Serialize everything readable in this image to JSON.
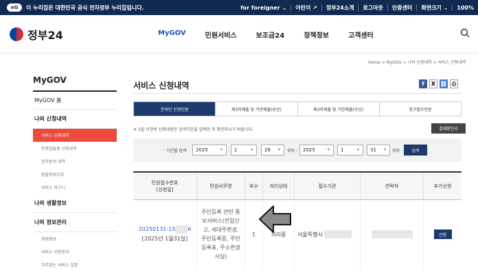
{
  "topbar": {
    "notice": "이 누리집은 대한민국 공식 전자정부 누리집입니다.",
    "links": [
      "for foreigner ⌄",
      "어린이 ↗",
      "정부24소개",
      "로그아웃",
      "인증센터",
      "화면크기 ⌄",
      "100%"
    ]
  },
  "header": {
    "logo_text": "정부24",
    "nav": [
      "MyGOV",
      "민원서비스",
      "보조금24",
      "정책정보",
      "고객센터"
    ]
  },
  "breadcrumb": "Home  >  MyGOV  >  나의 신청내역  >  서비스 신청내역",
  "sidebar": {
    "title": "MyGOV",
    "home": "MyGOV 홈",
    "group1": "나의 신청내역",
    "group1_items": [
      "서비스 신청내역",
      "온종일돌봄 신청내역",
      "전자문서 내역",
      "환불정보조회",
      "서비스 바구니"
    ],
    "group2": "나의 생활정보",
    "group3": "나의 정보관리",
    "group3_items": [
      "회원정보",
      "서비스 이용동의",
      "자주찾는 서비스 설정"
    ]
  },
  "main": {
    "title": "서비스 신청내역",
    "tabs": [
      "온라인 신청민원",
      "제3자제출 및 기관제출(송신)",
      "제3자제출 및 기관제출(수신)",
      "청구접수민원"
    ],
    "note": "※ 3일 이전의 신청내용은 검색기간을 입력한 후 확인하시기 바랍니다.",
    "cert_button": "결제확인서",
    "filter": {
      "label": "· 기간별 검색",
      "from_year": "2025",
      "from_month": "1",
      "from_day": "28",
      "sep": "부터 -",
      "to_year": "2025",
      "to_month": "1",
      "to_day": "31",
      "until": "까지",
      "search": "검색"
    },
    "table": {
      "headers": [
        "민원접수번호\n[신청일]",
        "민원사무명",
        "부수",
        "처리상태",
        "접수기관",
        "연락처",
        "추가신청"
      ],
      "row": {
        "receipt_no": "20250131-15",
        "receipt_no_tail": "6",
        "date": "[2025년 1월31일]",
        "service": "주민등록 관련 통보서비스(전입신고, 세대주변경, 주민등록증, 주민등록표, 주소변경사실)",
        "copies": "1",
        "status": "처리중",
        "agency": "서울특별시",
        "apply": "신청"
      }
    }
  },
  "colors": {
    "topbar": "#102a52",
    "accent_blue": "#1a55b8",
    "active_tab": "#1c3a6e",
    "sidebar_active": "#ea4b3c"
  }
}
